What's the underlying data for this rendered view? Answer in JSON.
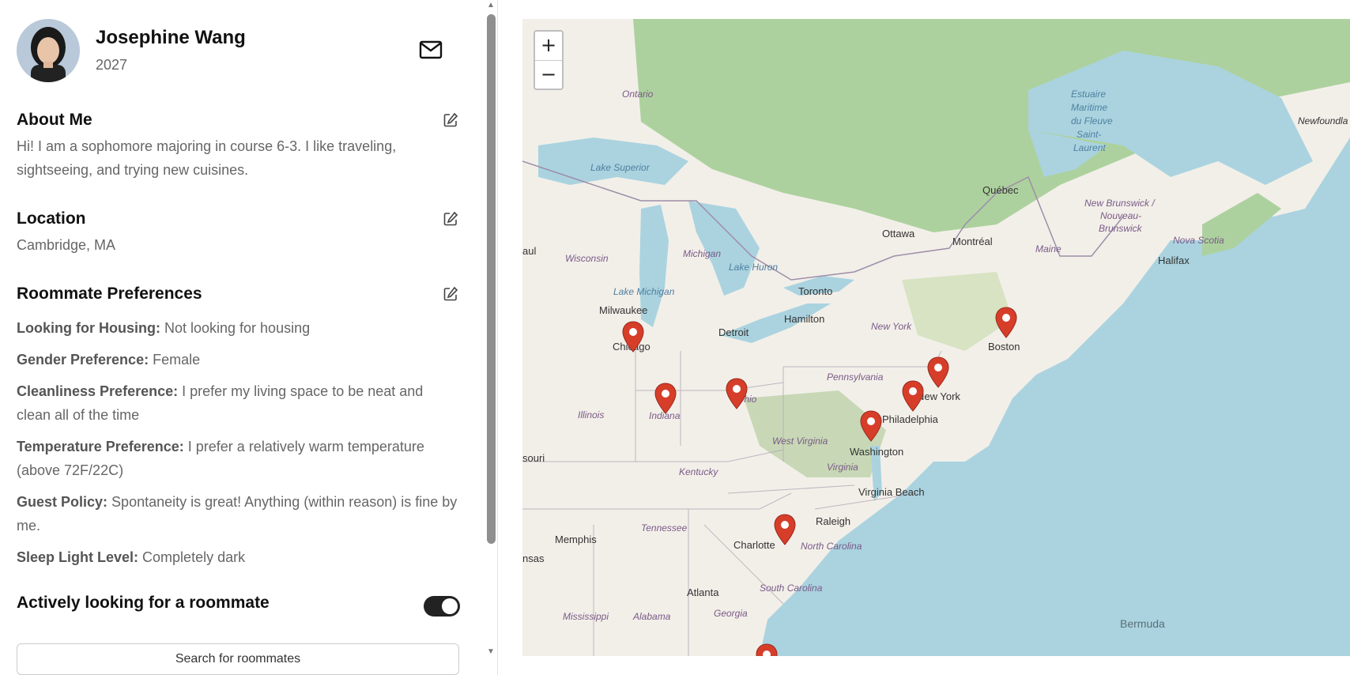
{
  "profile": {
    "name": "Josephine Wang",
    "year": "2027"
  },
  "about": {
    "title": "About Me",
    "text": "Hi! I am a sophomore majoring in course 6-3. I like traveling, sightseeing, and trying new cuisines."
  },
  "location": {
    "title": "Location",
    "value": "Cambridge, MA"
  },
  "preferences": {
    "title": "Roommate Preferences",
    "items": [
      {
        "label": "Looking for Housing:",
        "value": "Not looking for housing"
      },
      {
        "label": "Gender Preference:",
        "value": "Female"
      },
      {
        "label": "Cleanliness Preference:",
        "value": "I prefer my living space to be neat and clean all of the time"
      },
      {
        "label": "Temperature Preference:",
        "value": "I prefer a relatively warm temperature (above 72F/22C)"
      },
      {
        "label": "Guest Policy:",
        "value": "Spontaneity is great! Anything (within reason) is fine by me."
      },
      {
        "label": "Sleep Light Level:",
        "value": "Completely dark"
      }
    ]
  },
  "roommate_toggle": {
    "label": "Actively looking for a roommate",
    "on": true
  },
  "bottom_button": {
    "label": "Search for roommates"
  },
  "map": {
    "zoom_in": "+",
    "zoom_out": "−",
    "labels": {
      "ontario": "Ontario",
      "lake_superior": "Lake Superior",
      "estuaire": "Estuaire",
      "maritime": "Maritime",
      "du_fleuve": "du Fleuve",
      "saint": "Saint-",
      "laurent": "Laurent",
      "newfoundland": "Newfoundla",
      "quebec": "Québec",
      "new_brunswick_1": "New Brunswick /",
      "new_brunswick_2": "Nouveau-",
      "new_brunswick_3": "Brunswick",
      "ottawa": "Ottawa",
      "montreal": "Montréal",
      "nova_scotia": "Nova Scotia",
      "maine": "Maine",
      "halifax": "Halifax",
      "aul": "aul",
      "wisconsin": "Wisconsin",
      "michigan": "Michigan",
      "lake_huron": "Lake Huron",
      "toronto": "Toronto",
      "lake_michigan": "Lake Michigan",
      "milwaukee": "Milwaukee",
      "hamilton": "Hamilton",
      "detroit": "Detroit",
      "new_york_state": "New York",
      "chicago": "Chicago",
      "boston": "Boston",
      "pennsylvania": "Pennsylvania",
      "new_york": "New York",
      "ohio": "Ohio",
      "illinois": "Illinois",
      "indiana": "Indiana",
      "philadelphia": "Philadelphia",
      "west_virginia": "West Virginia",
      "washington": "Washington",
      "souri": "souri",
      "virginia": "Virginia",
      "kentucky": "Kentucky",
      "virginia_beach": "Virginia Beach",
      "raleigh": "Raleigh",
      "tennessee": "Tennessee",
      "memphis": "Memphis",
      "charlotte": "Charlotte",
      "north_carolina": "North Carolina",
      "nsas": "nsas",
      "atlanta": "Atlanta",
      "south_carolina": "South Carolina",
      "mississippi": "Mississippi",
      "alabama": "Alabama",
      "georgia": "Georgia",
      "bermuda": "Bermuda"
    }
  },
  "colors": {
    "water": "#aad3df",
    "land": "#f2efe9",
    "forest": "#add19e",
    "pin": "#d63e2a",
    "toggle": "#222222"
  }
}
